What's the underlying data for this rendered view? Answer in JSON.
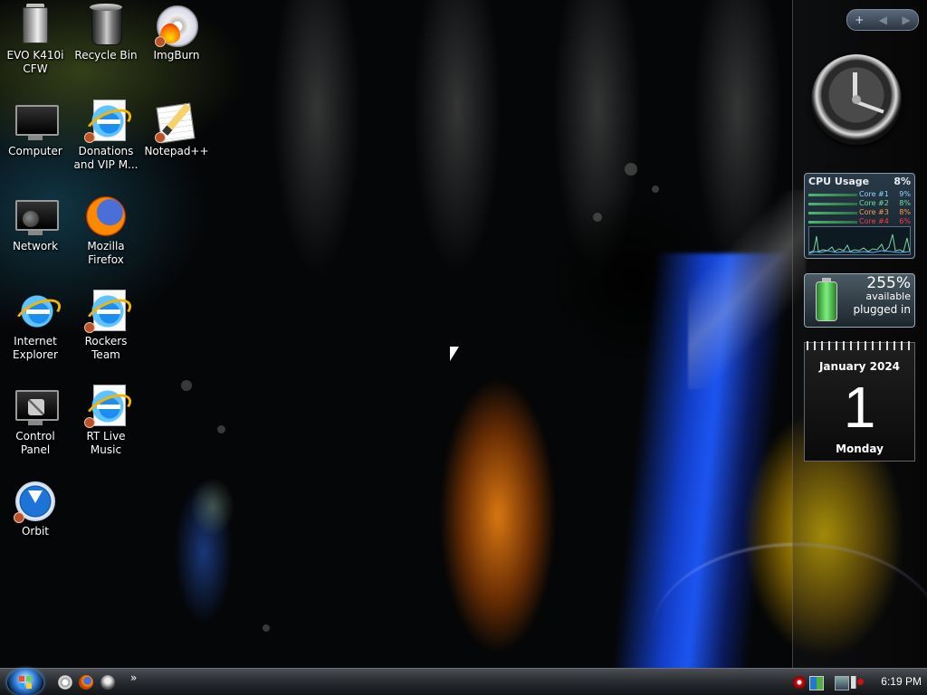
{
  "desktop": {
    "icons": [
      {
        "label": "EVO K410i CFW",
        "icon": "folder-icon"
      },
      {
        "label": "Recycle Bin",
        "icon": "recycle-bin-icon"
      },
      {
        "label": "ImgBurn",
        "icon": "imgburn-icon"
      },
      {
        "label": "Computer",
        "icon": "computer-icon"
      },
      {
        "label": "Donations and VIP M...",
        "icon": "internet-shortcut-icon"
      },
      {
        "label": "Notepad++",
        "icon": "notepad-icon"
      },
      {
        "label": "Network",
        "icon": "network-icon"
      },
      {
        "label": "Mozilla Firefox",
        "icon": "firefox-icon"
      },
      {
        "label": "Internet Explorer",
        "icon": "internet-explorer-icon"
      },
      {
        "label": "Rockers Team",
        "icon": "internet-shortcut-icon"
      },
      {
        "label": "Control Panel",
        "icon": "control-panel-icon"
      },
      {
        "label": "RT Live Music",
        "icon": "internet-shortcut-icon"
      },
      {
        "label": "Orbit",
        "icon": "orbit-downloader-icon"
      }
    ]
  },
  "sidebar": {
    "controls": {
      "add": "+",
      "prev": "◀",
      "next": "▶"
    },
    "cpu": {
      "title": "CPU Usage",
      "total": "8%",
      "cores": [
        {
          "name": "Core #1",
          "value": "9%",
          "color": "#8fd6ff"
        },
        {
          "name": "Core #2",
          "value": "8%",
          "color": "#6fe0a0"
        },
        {
          "name": "Core #3",
          "value": "8%",
          "color": "#ff9a4a"
        },
        {
          "name": "Core #4",
          "value": "6%",
          "color": "#ff3a3a"
        }
      ]
    },
    "battery": {
      "percent": "255%",
      "available_label": "available",
      "status": "plugged in"
    },
    "calendar": {
      "month_year": "January 2024",
      "day": "1",
      "weekday": "Monday"
    }
  },
  "taskbar": {
    "quick_launch_more": "»",
    "time": "6:19 PM"
  },
  "colors": {
    "taskbar": "#2a2d31",
    "accent": "#2d7ad6"
  }
}
